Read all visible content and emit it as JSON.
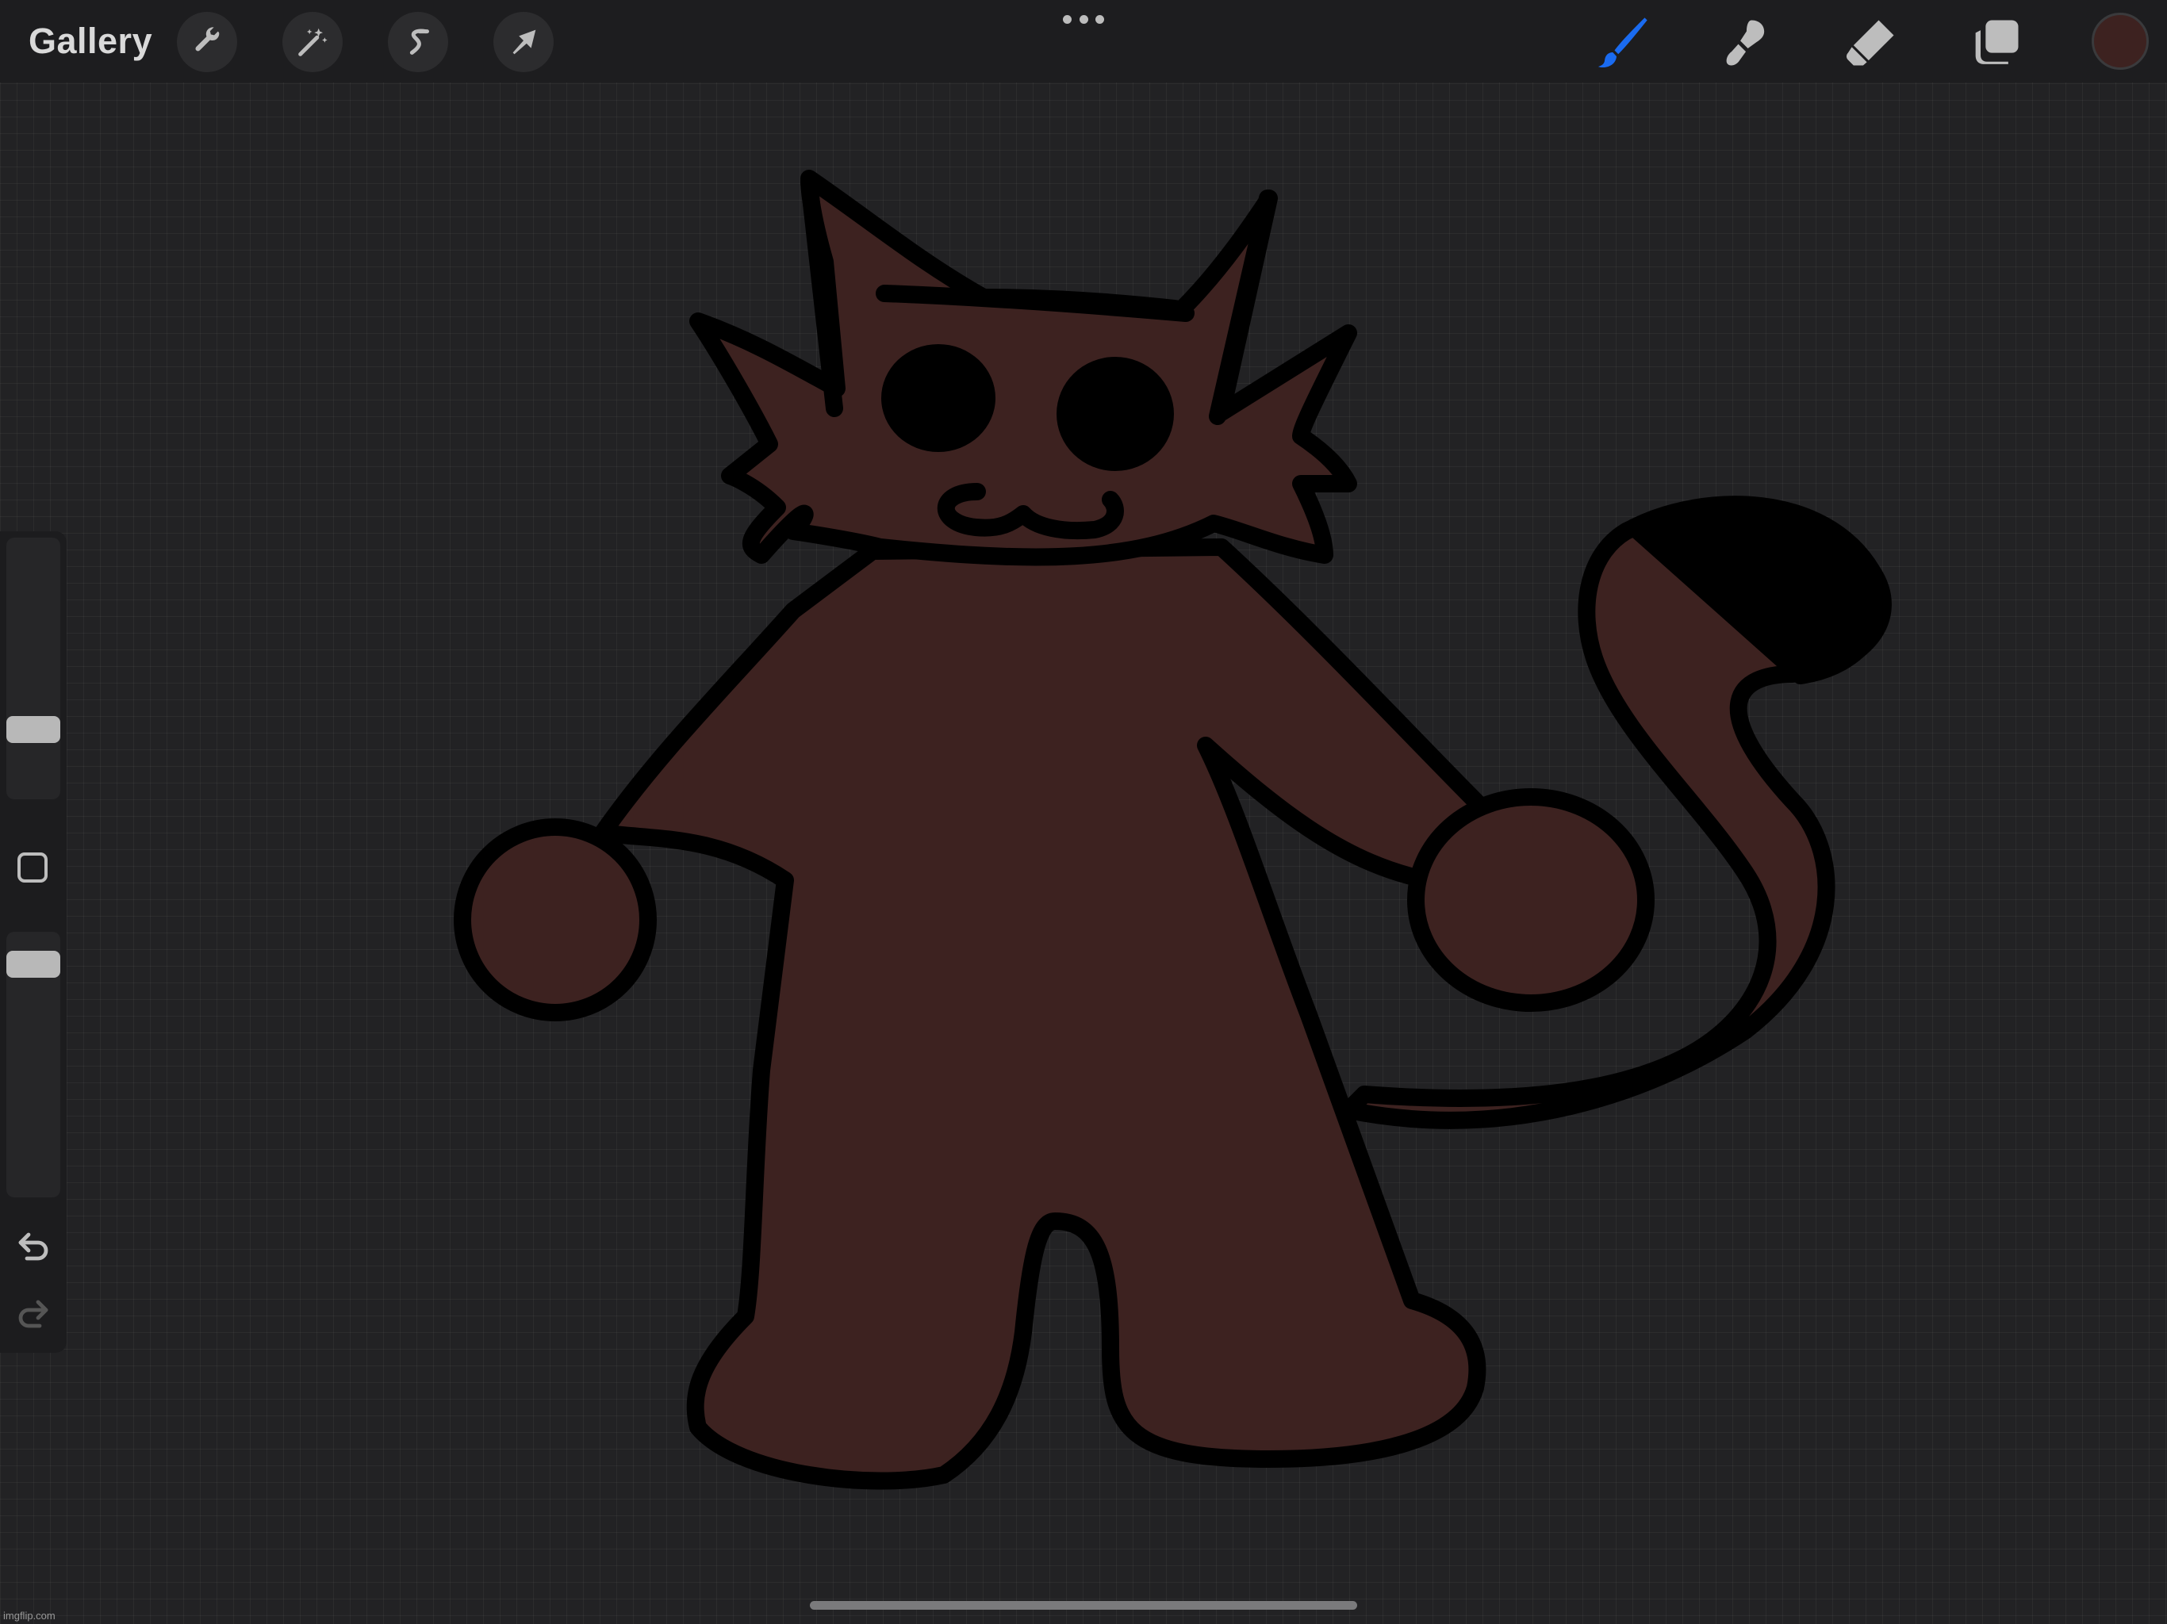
{
  "topbar": {
    "gallery_label": "Gallery",
    "left_tools": [
      {
        "name": "actions",
        "icon": "wrench-icon"
      },
      {
        "name": "adjustments",
        "icon": "magic-wand-icon"
      },
      {
        "name": "selection",
        "icon": "selection-s-icon"
      },
      {
        "name": "transform",
        "icon": "arrow-cursor-icon"
      }
    ],
    "more_icon": "more-dots-icon",
    "right_tools": [
      {
        "name": "brush",
        "icon": "brush-icon",
        "active": true
      },
      {
        "name": "smudge",
        "icon": "smudge-icon",
        "active": false
      },
      {
        "name": "eraser",
        "icon": "eraser-icon",
        "active": false
      },
      {
        "name": "layers",
        "icon": "layers-icon",
        "active": false
      }
    ],
    "current_color": "#3d2220"
  },
  "sidebar": {
    "brush_size_level": 0.24,
    "opacity_level": 0.92,
    "modify_icon": "modify-square-icon",
    "undo_icon": "undo-icon",
    "redo_icon": "redo-icon"
  },
  "canvas": {
    "drawing_subject": "cat-character",
    "fill_color": "#3d2220",
    "outline_color": "#000000"
  },
  "watermark": "imgflip.com",
  "colors": {
    "accent_active": "#1a6bf0",
    "icon_default": "#bdbdbd"
  }
}
